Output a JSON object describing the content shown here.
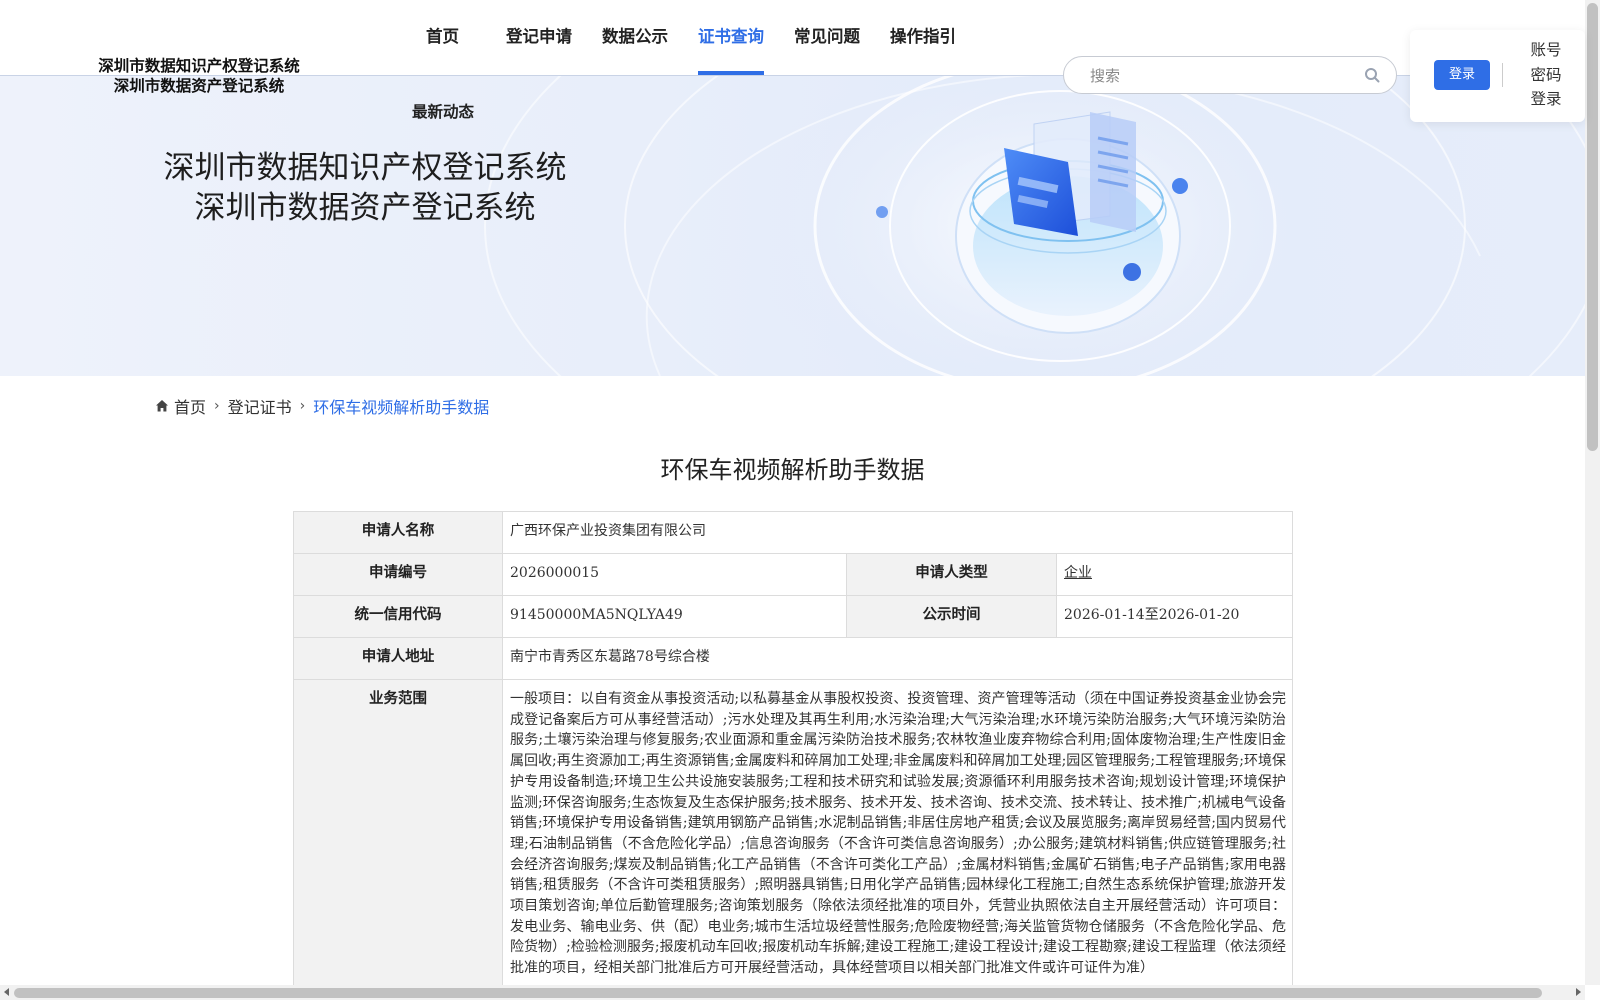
{
  "header": {
    "logo_line1": "深圳市数据知识产权登记系统",
    "logo_line2": "深圳市数据资产登记系统",
    "nav": [
      {
        "label": "首页"
      },
      {
        "label": "登记申请"
      },
      {
        "label": "数据公示"
      },
      {
        "label": "证书查询"
      },
      {
        "label": "常见问题"
      },
      {
        "label": "操作指引"
      }
    ],
    "nav_sub": "最新动态",
    "active_nav": "证书查询",
    "search_placeholder": "搜索",
    "login_button": "登录",
    "account_login": "账号密码登录",
    "account_login_lines": [
      "账号",
      "密码",
      "登录"
    ],
    "accent_color": "#2f6ee6"
  },
  "banner": {
    "title_line1": "深圳市数据知识产权登记系统",
    "title_line2": "深圳市数据资产登记系统"
  },
  "breadcrumb": {
    "home": "首页",
    "level2": "登记证书",
    "current": "环保车视频解析助手数据"
  },
  "page_title": "环保车视频解析助手数据",
  "details": {
    "applicant_name_label": "申请人名称",
    "applicant_name": "广西环保产业投资集团有限公司",
    "app_no_label": "申请编号",
    "app_no": "2026000015",
    "applicant_type_label": "申请人类型",
    "applicant_type": "企业",
    "credit_code_label": "统一信用代码",
    "credit_code": "91450000MA5NQLYA49",
    "publicity_label": "公示时间",
    "publicity": "2026-01-14至2026-01-20",
    "address_label": "申请人地址",
    "address": "南宁市青秀区东葛路78号综合楼",
    "scope_label": "业务范围",
    "scope": "一般项目：以自有资金从事投资活动;以私募基金从事股权投资、投资管理、资产管理等活动（须在中国证券投资基金业协会完成登记备案后方可从事经营活动）;污水处理及其再生利用;水污染治理;大气污染治理;水环境污染防治服务;大气环境污染防治服务;土壤污染治理与修复服务;农业面源和重金属污染防治技术服务;农林牧渔业废弃物综合利用;固体废物治理;生产性废旧金属回收;再生资源加工;再生资源销售;金属废料和碎屑加工处理;非金属废料和碎屑加工处理;园区管理服务;工程管理服务;环境保护专用设备制造;环境卫生公共设施安装服务;工程和技术研究和试验发展;资源循环利用服务技术咨询;规划设计管理;环境保护监测;环保咨询服务;生态恢复及生态保护服务;技术服务、技术开发、技术咨询、技术交流、技术转让、技术推广;机械电气设备销售;环境保护专用设备销售;建筑用钢筋产品销售;水泥制品销售;非居住房地产租赁;会议及展览服务;离岸贸易经营;国内贸易代理;石油制品销售（不含危险化学品）;信息咨询服务（不含许可类信息咨询服务）;办公服务;建筑材料销售;供应链管理服务;社会经济咨询服务;煤炭及制品销售;化工产品销售（不含许可类化工产品）;金属材料销售;金属矿石销售;电子产品销售;家用电器销售;租赁服务（不含许可类租赁服务）;照明器具销售;日用化学产品销售;园林绿化工程施工;自然生态系统保护管理;旅游开发项目策划咨询;单位后勤管理服务;咨询策划服务（除依法须经批准的项目外，凭营业执照依法自主开展经营活动）许可项目：发电业务、输电业务、供（配）电业务;城市生活垃圾经营性服务;危险废物经营;海关监管货物仓储服务（不含危险化学品、危险货物）;检验检测服务;报废机动车回收;报废机动车拆解;建设工程施工;建设工程设计;建设工程勘察;建设工程监理（依法须经批准的项目，经相关部门批准后方可开展经营活动，具体经营项目以相关部门批准文件或许可证件为准）"
  }
}
